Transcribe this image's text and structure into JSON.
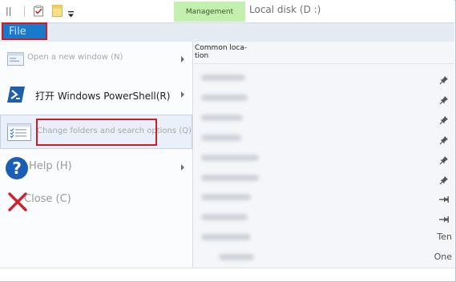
{
  "window": {
    "title": "Local disk (D :)",
    "context_tab": "Management"
  },
  "quick_access": {
    "pipe": "||"
  },
  "ribbon": {
    "file_tab": "File"
  },
  "file_menu": {
    "items": [
      {
        "label": "Open a new window (N)",
        "icon": "window-icon",
        "has_submenu": true,
        "enabled": false
      },
      {
        "label": "打开 Windows PowerShell(R)",
        "icon": "powershell-icon",
        "has_submenu": true,
        "enabled": true
      },
      {
        "label": "Change folders and search options (Q)",
        "icon": "folder-options-icon",
        "has_submenu": false,
        "enabled": true,
        "highlighted": true
      },
      {
        "label": "Help (H)",
        "icon": "help-icon",
        "has_submenu": true,
        "enabled": true
      },
      {
        "label": "Close (C)",
        "icon": "close-icon",
        "has_submenu": false,
        "enabled": true
      }
    ]
  },
  "common_locations": {
    "header": "Common loca-\ntion",
    "rows": [
      {
        "pin": "pinned",
        "text": ""
      },
      {
        "pin": "pinned",
        "text": ""
      },
      {
        "pin": "pinned",
        "text": ""
      },
      {
        "pin": "pinned",
        "text": ""
      },
      {
        "pin": "pinned",
        "text": ""
      },
      {
        "pin": "pinned",
        "text": ""
      },
      {
        "pin": "unpinned",
        "text": ""
      },
      {
        "pin": "unpinned",
        "text": ""
      },
      {
        "pin": "none",
        "text": "Ten"
      },
      {
        "pin": "none",
        "text": "One"
      }
    ]
  },
  "colors": {
    "accent": "#1979ca",
    "highlight": "#d01c26",
    "management": "#c3efaf"
  }
}
